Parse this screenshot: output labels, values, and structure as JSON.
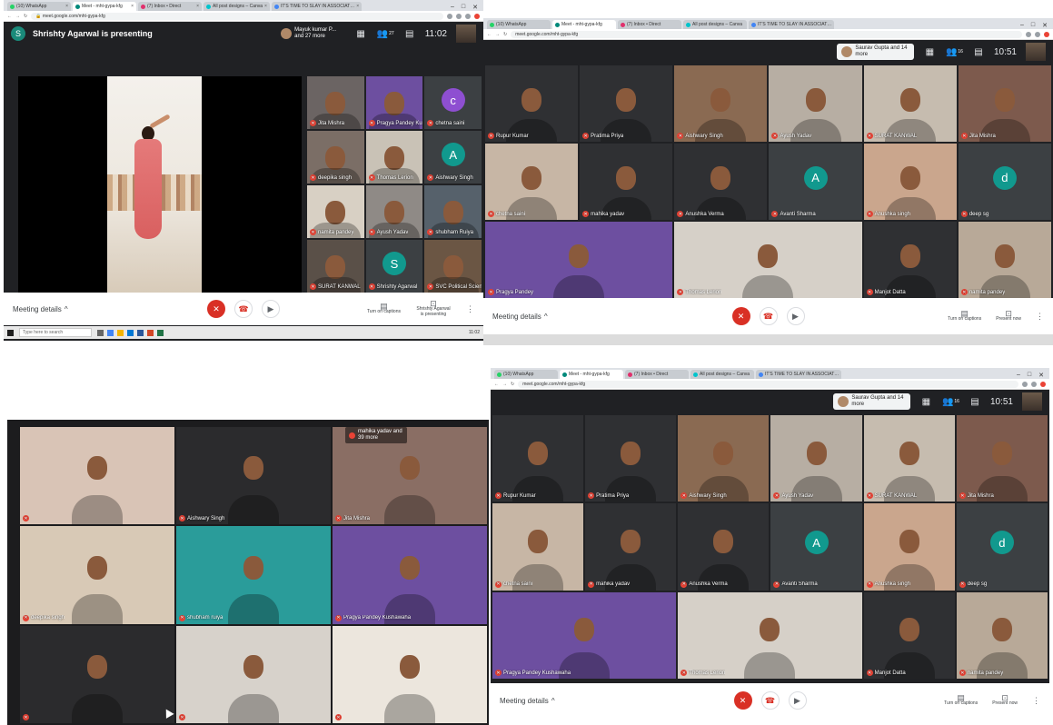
{
  "colors": {
    "meet_dark": "#202124",
    "tile_gray": "#3c4043",
    "mic_red": "#ea4335",
    "end_call_red": "#d93025",
    "avatar_purple": "#8e4fd1",
    "avatar_teal": "#11998e",
    "avatar_blue": "#0f9d58"
  },
  "browser": {
    "tabs": [
      "(10) WhatsApp",
      "Meet - mht-gypa-kfg",
      "(7) Inbox • Direct",
      "All post designs – Canva",
      "IT'S TIME TO SLAY IN ASSOCIAT…"
    ],
    "url": "meet.google.com/mht-gypa-kfg"
  },
  "panel1": {
    "presenter_initial": "S",
    "presenting_title": "Shrishty Agarwal is presenting",
    "others": "Mayuk kumar P... and 27 more",
    "people_count": "27",
    "clock": "11:02",
    "tiles": [
      {
        "name": "Jita Mishra",
        "kind": "video",
        "bg": "#6b6463"
      },
      {
        "name": "Pragya Pandey Ku...",
        "kind": "video",
        "bg": "#6d4fa0"
      },
      {
        "name": "chetna saini",
        "kind": "avatar",
        "initial": "c",
        "color": "#8e4fd1"
      },
      {
        "name": "deepika singh",
        "kind": "video",
        "bg": "#7b6e66"
      },
      {
        "name": "Thomas Lerion",
        "kind": "video",
        "bg": "#c9c2b6"
      },
      {
        "name": "Aishwary Singh",
        "kind": "avatar",
        "initial": "A",
        "color": "#11998e"
      },
      {
        "name": "namita pandey",
        "kind": "video",
        "bg": "#d8d0c4"
      },
      {
        "name": "Ayush Yadav",
        "kind": "video",
        "bg": "#8f8a86"
      },
      {
        "name": "shubham Ruiya",
        "kind": "video",
        "bg": "#56616b"
      },
      {
        "name": "SURAT KANWAL",
        "kind": "video",
        "bg": "#5a5048"
      },
      {
        "name": "Shrishty Agarwal",
        "kind": "avatar",
        "initial": "S",
        "color": "#11998e"
      },
      {
        "name": "SVC Political Scien...",
        "kind": "video",
        "bg": "#6b5644"
      }
    ],
    "meeting_details": "Meeting details",
    "captions_label": "Turn on captions",
    "presenting_label": "Shrishty Agarwal is presenting",
    "search_placeholder": "Type here to search",
    "taskbar_time": "11:02"
  },
  "panel2": {
    "others": "Saurav Gupta and 14 more",
    "people_count": "16",
    "clock": "10:51",
    "tiles": [
      {
        "name": "Rupur Kumar",
        "kind": "video",
        "bg": "#2f3033"
      },
      {
        "name": "Pratima Priya",
        "kind": "video",
        "bg": "#2f3033"
      },
      {
        "name": "Aishwary Singh",
        "kind": "video",
        "bg": "#8a6a52"
      },
      {
        "name": "Ayush Yadav",
        "kind": "video",
        "bg": "#b7aea3"
      },
      {
        "name": "SURAT KANWAL",
        "kind": "video",
        "bg": "#c6bcaf"
      },
      {
        "name": "Jita Mishra",
        "kind": "video",
        "bg": "#7d5a4d"
      },
      {
        "name": "chetna saini",
        "kind": "video",
        "bg": "#c7b6a5"
      },
      {
        "name": "mahika yadav",
        "kind": "video",
        "bg": "#2f3033"
      },
      {
        "name": "Anushka Verma",
        "kind": "video",
        "bg": "#2f3033"
      },
      {
        "name": "Avanti Sharma",
        "kind": "avatar",
        "initial": "A",
        "color": "#11998e"
      },
      {
        "name": "Anushka singh",
        "kind": "video",
        "bg": "#caa68d"
      },
      {
        "name": "deep sg",
        "kind": "avatar",
        "initial": "d",
        "color": "#11998e"
      },
      {
        "name": "Pragya Pandey",
        "kind": "video",
        "bg": "#6d4fa0"
      },
      {
        "name": "Thomas Lerion",
        "kind": "video",
        "bg": "#d6d0c8"
      },
      {
        "name": "Manjot Datta",
        "kind": "video",
        "bg": "#2f3033"
      },
      {
        "name": "namita pandey",
        "kind": "video",
        "bg": "#b8a998"
      }
    ],
    "meeting_details": "Meeting details",
    "captions_label": "Turn on captions",
    "present_label": "Present now"
  },
  "panel3": {
    "others": "mahika yadav and 39 more",
    "tiles": [
      {
        "name": "",
        "kind": "video",
        "bg": "#d9c4b6"
      },
      {
        "name": "Aishwary Singh",
        "kind": "video",
        "bg": "#2b2b2d"
      },
      {
        "name": "Jita Mishra",
        "kind": "video",
        "bg": "#8a6e64"
      },
      {
        "name": "deepika singh",
        "kind": "video",
        "bg": "#d8c9b6"
      },
      {
        "name": "shubham ruiya",
        "kind": "video",
        "bg": "#2a9c9a"
      },
      {
        "name": "Pragya Pandey Kushawaha",
        "kind": "video",
        "bg": "#6d4fa0"
      },
      {
        "name": "",
        "kind": "video",
        "bg": "#2b2b2d"
      },
      {
        "name": "",
        "kind": "video",
        "bg": "#d7d2cb"
      },
      {
        "name": "",
        "kind": "video",
        "bg": "#ece6dd"
      }
    ]
  },
  "panel4": {
    "others": "Saurav Gupta and 14 more",
    "people_count": "16",
    "clock": "10:51",
    "tiles": [
      {
        "name": "Rupur Kumar",
        "kind": "video",
        "bg": "#2f3033"
      },
      {
        "name": "Pratima Priya",
        "kind": "video",
        "bg": "#2f3033"
      },
      {
        "name": "Aishwary Singh",
        "kind": "video",
        "bg": "#8a6a52"
      },
      {
        "name": "Ayush Yadav",
        "kind": "video",
        "bg": "#b7aea3"
      },
      {
        "name": "SURAT KANWAL",
        "kind": "video",
        "bg": "#c6bcaf"
      },
      {
        "name": "Jita Mishra",
        "kind": "video",
        "bg": "#7d5a4d"
      },
      {
        "name": "chetna saini",
        "kind": "video",
        "bg": "#c7b6a5"
      },
      {
        "name": "mahika yadav",
        "kind": "video",
        "bg": "#2f3033"
      },
      {
        "name": "Anushka Verma",
        "kind": "video",
        "bg": "#2f3033"
      },
      {
        "name": "Avanti Sharma",
        "kind": "avatar",
        "initial": "A",
        "color": "#11998e"
      },
      {
        "name": "Anushka singh",
        "kind": "video",
        "bg": "#caa68d"
      },
      {
        "name": "deep sg",
        "kind": "avatar",
        "initial": "d",
        "color": "#11998e"
      },
      {
        "name": "Pragya Pandey Kushawaha",
        "kind": "video",
        "bg": "#6d4fa0"
      },
      {
        "name": "Thomas Lerion",
        "kind": "video",
        "bg": "#d6d0c8"
      },
      {
        "name": "Manjot Datta",
        "kind": "video",
        "bg": "#2f3033"
      },
      {
        "name": "namita pandey",
        "kind": "video",
        "bg": "#b8a998"
      }
    ],
    "meeting_details": "Meeting details",
    "captions_label": "Turn on captions",
    "present_label": "Present now"
  },
  "icons": {
    "mic": "mic-off-icon",
    "hangup": "hangup-icon",
    "cam": "camera-icon",
    "people": "people-icon",
    "chat": "chat-icon",
    "grid": "layout-icon",
    "captions": "captions-icon",
    "present": "present-icon",
    "more": "more-vert-icon",
    "chevron": "chevron-up-icon"
  }
}
